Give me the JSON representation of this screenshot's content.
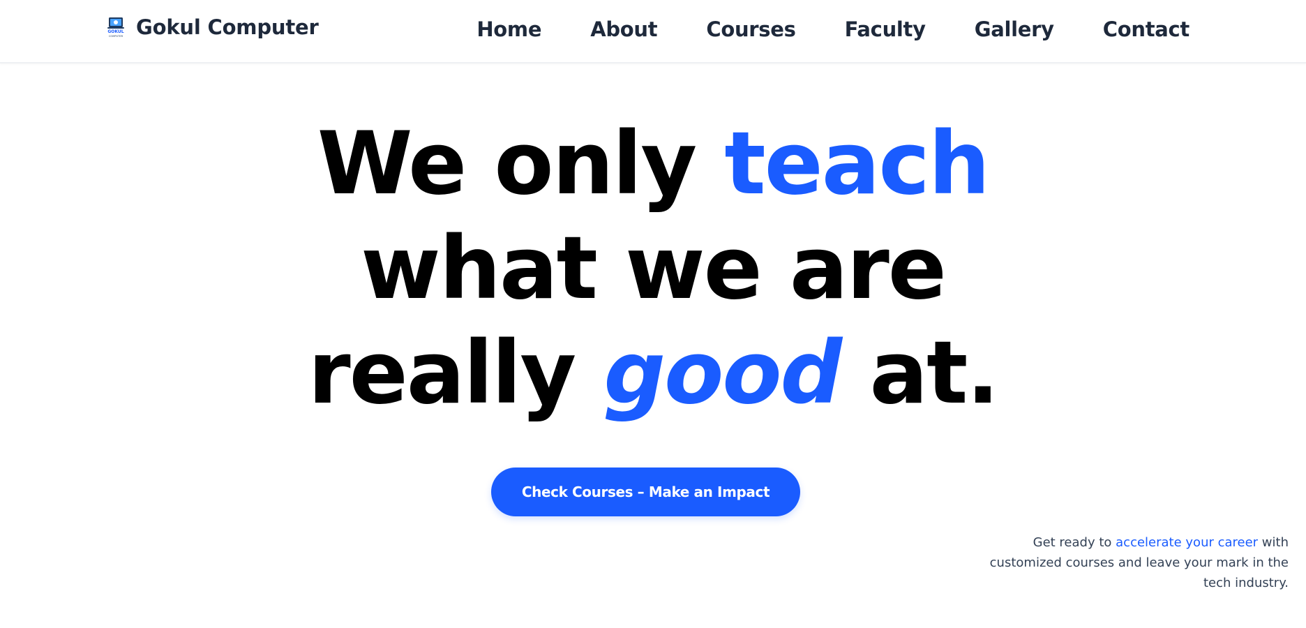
{
  "header": {
    "brand_name": "Gokul Computer",
    "logo_text_top": "GOKUL",
    "logo_text_bottom": "COMPUTER",
    "nav": [
      {
        "label": "Home"
      },
      {
        "label": "About"
      },
      {
        "label": "Courses"
      },
      {
        "label": "Faculty"
      },
      {
        "label": "Gallery"
      },
      {
        "label": "Contact"
      }
    ]
  },
  "hero": {
    "headline": {
      "line1_part1": "We only ",
      "line1_highlight": "teach",
      "line2": "what we are",
      "line3_part1": "really ",
      "line3_highlight": "good",
      "line3_part2": " at."
    },
    "cta_label": "Check Courses – Make an Impact",
    "tagline": {
      "before": "Get ready to ",
      "highlight": "accelerate your career",
      "after": " with customized courses and leave your mark in the tech industry."
    }
  },
  "colors": {
    "accent": "#1a5cff",
    "heading": "#000000",
    "nav_text": "#1e293b",
    "body_text": "#334155"
  }
}
